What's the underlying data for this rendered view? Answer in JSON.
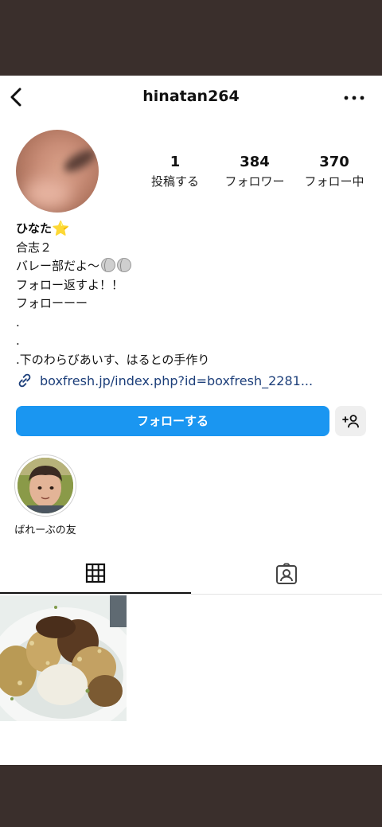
{
  "header": {
    "username": "hinatan264",
    "back_icon": "chevron-left-icon",
    "more_icon": "more-horizontal-icon"
  },
  "stats": [
    {
      "value": "1",
      "label": "投稿する"
    },
    {
      "value": "384",
      "label": "フォロワー"
    },
    {
      "value": "370",
      "label": "フォロー中"
    }
  ],
  "bio": {
    "name": "ひなた",
    "name_emoji": "⭐",
    "lines": [
      "合志２",
      "バレー部だよ〜",
      "フォロー返すよ！！",
      "フォローーー",
      ".",
      ".",
      ".下のわらびあいす、はるとの手作り"
    ],
    "volleyball_emoji_count": "2"
  },
  "link": {
    "text": "boxfresh.jp/index.php?id=boxfresh_2281...",
    "icon": "link-icon"
  },
  "actions": {
    "follow_label": "フォローする",
    "add_user_icon": "add-person-icon"
  },
  "highlights": [
    {
      "label": "ばれーぶの友"
    }
  ],
  "tabs": {
    "grid_icon": "grid-icon",
    "tagged_icon": "tagged-person-icon"
  },
  "colors": {
    "accent": "#1a96f1",
    "link": "#1d3f7a",
    "background": "#ffffff",
    "frame": "#3a2f2c"
  }
}
